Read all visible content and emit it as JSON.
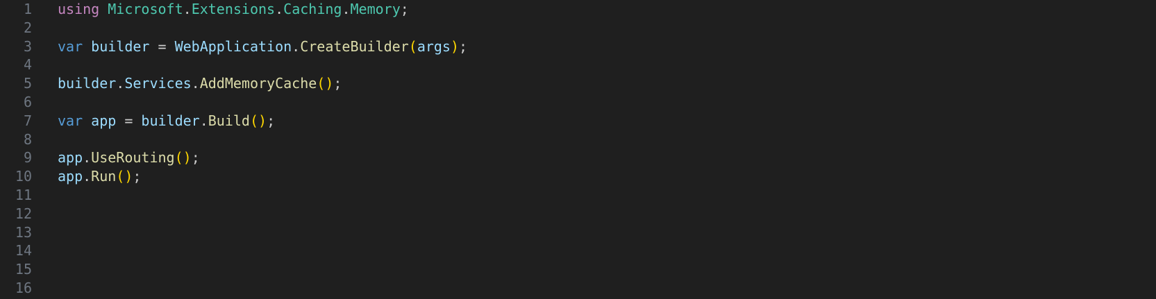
{
  "editor": {
    "line_numbers": [
      "1",
      "2",
      "3",
      "4",
      "5",
      "6",
      "7",
      "8",
      "9",
      "10",
      "11",
      "12",
      "13",
      "14",
      "15",
      "16"
    ],
    "lines": [
      {
        "tokens": [
          {
            "t": "using",
            "c": "kw-control"
          },
          {
            "t": " ",
            "c": "punc"
          },
          {
            "t": "Microsoft",
            "c": "type"
          },
          {
            "t": ".",
            "c": "punc"
          },
          {
            "t": "Extensions",
            "c": "type"
          },
          {
            "t": ".",
            "c": "punc"
          },
          {
            "t": "Caching",
            "c": "type"
          },
          {
            "t": ".",
            "c": "punc"
          },
          {
            "t": "Memory",
            "c": "type"
          },
          {
            "t": ";",
            "c": "punc"
          }
        ]
      },
      {
        "tokens": []
      },
      {
        "tokens": [
          {
            "t": "var",
            "c": "kw"
          },
          {
            "t": " ",
            "c": "punc"
          },
          {
            "t": "builder",
            "c": "var"
          },
          {
            "t": " = ",
            "c": "punc"
          },
          {
            "t": "WebApplication",
            "c": "var"
          },
          {
            "t": ".",
            "c": "punc"
          },
          {
            "t": "CreateBuilder",
            "c": "fn"
          },
          {
            "t": "(",
            "c": "paren"
          },
          {
            "t": "args",
            "c": "var"
          },
          {
            "t": ")",
            "c": "paren"
          },
          {
            "t": ";",
            "c": "punc"
          }
        ]
      },
      {
        "tokens": []
      },
      {
        "tokens": [
          {
            "t": "builder",
            "c": "var"
          },
          {
            "t": ".",
            "c": "punc"
          },
          {
            "t": "Services",
            "c": "var"
          },
          {
            "t": ".",
            "c": "punc"
          },
          {
            "t": "AddMemoryCache",
            "c": "fn"
          },
          {
            "t": "()",
            "c": "paren"
          },
          {
            "t": ";",
            "c": "punc"
          }
        ]
      },
      {
        "tokens": []
      },
      {
        "tokens": [
          {
            "t": "var",
            "c": "kw"
          },
          {
            "t": " ",
            "c": "punc"
          },
          {
            "t": "app",
            "c": "var"
          },
          {
            "t": " = ",
            "c": "punc"
          },
          {
            "t": "builder",
            "c": "var"
          },
          {
            "t": ".",
            "c": "punc"
          },
          {
            "t": "Build",
            "c": "fn"
          },
          {
            "t": "()",
            "c": "paren"
          },
          {
            "t": ";",
            "c": "punc"
          }
        ]
      },
      {
        "tokens": []
      },
      {
        "tokens": [
          {
            "t": "app",
            "c": "var"
          },
          {
            "t": ".",
            "c": "punc"
          },
          {
            "t": "UseRouting",
            "c": "fn"
          },
          {
            "t": "()",
            "c": "paren"
          },
          {
            "t": ";",
            "c": "punc"
          }
        ]
      },
      {
        "tokens": [
          {
            "t": "app",
            "c": "var"
          },
          {
            "t": ".",
            "c": "punc"
          },
          {
            "t": "Run",
            "c": "fn"
          },
          {
            "t": "()",
            "c": "paren"
          },
          {
            "t": ";",
            "c": "punc"
          }
        ]
      },
      {
        "tokens": []
      },
      {
        "tokens": []
      },
      {
        "tokens": []
      },
      {
        "tokens": []
      },
      {
        "tokens": []
      },
      {
        "tokens": []
      }
    ]
  },
  "colors": {
    "background": "#1f1f1f",
    "line_number": "#6e7681",
    "keyword_control": "#c586c0",
    "keyword": "#569cd6",
    "type": "#4ec9b0",
    "variable": "#9cdcfe",
    "function": "#dcdcaa",
    "bracket": "#ffd700",
    "punctuation": "#cccccc"
  }
}
